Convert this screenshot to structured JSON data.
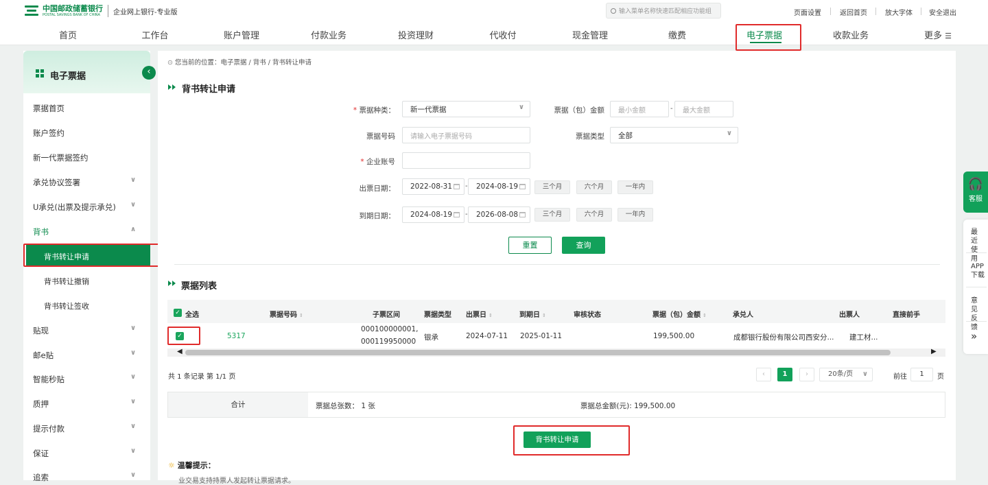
{
  "bank": {
    "name_cn": "中国邮政储蓄银行",
    "name_en": "POSTAL SAVINGS BANK OF CHINA",
    "subtitle": "企业网上银行-专业版"
  },
  "search": {
    "placeholder": "输入菜单名称快速匹配相应功能组"
  },
  "top_links": [
    "页面设置",
    "返回首页",
    "放大字体",
    "安全退出"
  ],
  "nav": [
    "首页",
    "工作台",
    "账户管理",
    "付款业务",
    "投资理财",
    "代收付",
    "现金管理",
    "缴费",
    "电子票据",
    "收款业务",
    "更多"
  ],
  "nav_active": "电子票据",
  "sidebar": {
    "title": "电子票据",
    "items": [
      "票据首页",
      "账户签约",
      "新一代票据签约",
      "承兑协议签署",
      "U承兑(出票及提示承兑)",
      "背书",
      "背书转让申请",
      "背书转让撤销",
      "背书转让签收",
      "贴现",
      "邮e贴",
      "智能秒贴",
      "质押",
      "提示付款",
      "保证",
      "追索"
    ],
    "active": "背书转让申请"
  },
  "breadcrumb": "您当前的位置：电子票据 / 背书 / 背书转让申请",
  "form": {
    "section_title": "背书转让申请",
    "bill_kind_label": "票据种类：",
    "bill_kind_value": "新一代票据",
    "amount_label": "票据（包）金额",
    "amount_min_ph": "最小金额",
    "amount_max_ph": "最大金额",
    "bill_no_label": "票据号码",
    "bill_no_ph": "请输入电子票据号码",
    "bill_type_label": "票据类型",
    "bill_type_value": "全部",
    "account_label": "企业账号",
    "issue_date_label": "出票日期：",
    "issue_from": "2022-08-31",
    "issue_to": "2024-08-19",
    "due_date_label": "到期日期：",
    "due_from": "2024-08-19",
    "due_to": "2026-08-08",
    "quick_ranges": [
      "三个月",
      "六个月",
      "一年内"
    ],
    "reset": "重置",
    "query": "查询"
  },
  "list": {
    "section_title": "票据列表",
    "select_all": "全选",
    "columns": [
      "票据号码",
      "子票区间",
      "票据类型",
      "出票日",
      "到期日",
      "审核状态",
      "票据（包）金额",
      "承兑人",
      "出票人",
      "直接前手"
    ],
    "rows": [
      {
        "bill_no": "5317",
        "sub_range_1": "000100000001,",
        "sub_range_2": "000119950000",
        "type": "银承",
        "issue_date": "2024-07-11",
        "due_date": "2025-01-11",
        "status": "",
        "amount": "199,500.00",
        "acceptor": "成都银行股份有限公司西安分...",
        "drawer": "建工材...",
        "prev_holder": ""
      }
    ],
    "records_text": "共 1 条记录  第 1/1 页",
    "current_page": "1",
    "page_size": "20条/页",
    "goto_label": "前往",
    "goto_value": "1",
    "page_suffix": "页"
  },
  "totals": {
    "label": "合计",
    "count": "票据总张数： 1 张",
    "sum": "票据总金额(元): 199,500.00"
  },
  "submit": "背书转让申请",
  "tip": {
    "title": "温馨提示：",
    "body": "业交易支持持票人发起转让票据请求。"
  },
  "float": {
    "service": "客服",
    "recent": "最近使用",
    "app": "APP下载",
    "feedback": "意见反馈",
    "more": "»"
  },
  "colors": {
    "brand_green": "#0b8a4c",
    "button_green": "#12a15a",
    "highlight_red": "#e02a2a"
  }
}
